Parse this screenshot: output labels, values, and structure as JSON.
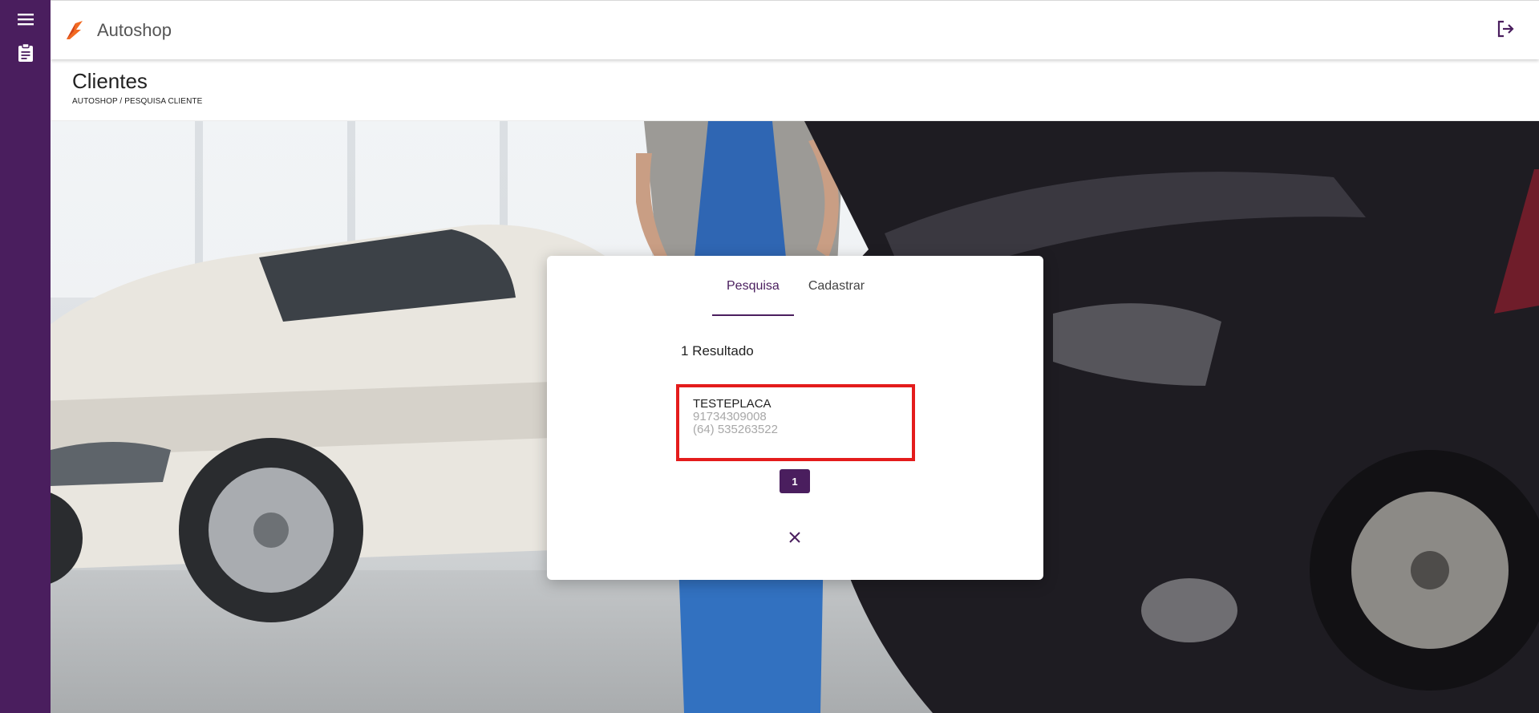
{
  "app": {
    "title": "Autoshop",
    "logo_icon": "autoshop-logo-icon"
  },
  "sidebar": {
    "items": [
      {
        "icon": "menu-icon"
      },
      {
        "icon": "clipboard-icon"
      }
    ]
  },
  "header": {
    "logout_icon": "logout-icon"
  },
  "page": {
    "title": "Clientes",
    "breadcrumb": "AUTOSHOP / PESQUISA CLIENTE"
  },
  "modal": {
    "tabs": [
      {
        "label": "Pesquisa",
        "active": true
      },
      {
        "label": "Cadastrar",
        "active": false
      }
    ],
    "result_count": "1 Resultado",
    "results": [
      {
        "name": "TESTEPLACA",
        "document": "91734309008",
        "phone": "(64) 535263522"
      }
    ],
    "pagination": {
      "current_page": "1"
    },
    "close_icon": "close-icon"
  },
  "colors": {
    "primary": "#4a1e5e",
    "highlight": "#e41c1c",
    "logo_orange": "#f26a22"
  }
}
